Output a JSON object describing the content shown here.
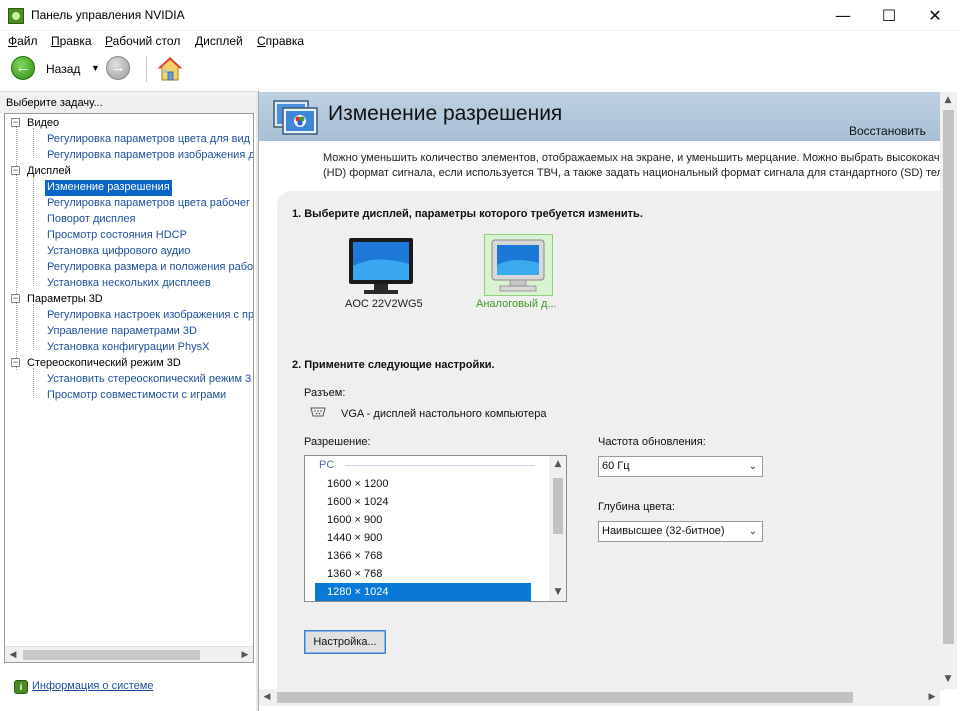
{
  "window": {
    "title": "Панель управления NVIDIA",
    "controls": {
      "minimize": "—",
      "maximize": "☐",
      "close": "✕"
    }
  },
  "menu": [
    {
      "label": "Файл",
      "accel": "Ф",
      "rest": "айл"
    },
    {
      "label": "Правка",
      "accel": "П",
      "rest": "равка"
    },
    {
      "label": "Рабочий стол",
      "accel": "Р",
      "rest": "абочий стол"
    },
    {
      "label": "Дисплей",
      "accel": "Д",
      "rest": "исплей"
    },
    {
      "label": "Справка",
      "accel": "С",
      "rest": "правка"
    }
  ],
  "toolbar": {
    "back_label": "Назад",
    "back_icon": "arrow-left-icon",
    "forward_icon": "arrow-right-icon",
    "home_icon": "home-icon",
    "dropdown_glyph": "▼"
  },
  "sidebar": {
    "header": "Выберите задачу...",
    "categories": [
      {
        "label": "Видео",
        "items": [
          "Регулировка параметров цвета для вид",
          "Регулировка параметров изображения д"
        ]
      },
      {
        "label": "Дисплей",
        "items": [
          "Изменение разрешения",
          "Регулировка параметров цвета рабочег",
          "Поворот дисплея",
          "Просмотр состояния HDCP",
          "Установка цифрового аудио",
          "Регулировка размера и положения рабо",
          "Установка нескольких дисплеев"
        ]
      },
      {
        "label": "Параметры 3D",
        "items": [
          "Регулировка настроек изображения с пр",
          "Управление параметрами 3D",
          "Установка конфигурации PhysX"
        ]
      },
      {
        "label": "Стереоскопический режим 3D",
        "items": [
          "Установить стереоскопический режим 3",
          "Просмотр совместимости с играми"
        ]
      }
    ],
    "selected_item": "Изменение разрешения",
    "system_info_link": "Информация о системе"
  },
  "main": {
    "title": "Изменение разрешения",
    "restore_link": "Восстановить",
    "description_line1": "Можно уменьшить количество элементов, отображаемых на экране, и уменьшить мерцание. Можно выбрать высококач",
    "description_line2": "(HD) формат сигнала, если используется ТВЧ, а также задать национальный формат сигнала для стандартного (SD) тел",
    "step1_title": "1. Выберите дисплей, параметры которого требуется изменить.",
    "displays": [
      {
        "label": "AOC 22V2WG5",
        "selected": false
      },
      {
        "label": "Аналоговый д...",
        "selected": true
      }
    ],
    "step2_title": "2. Примените следующие настройки.",
    "connector_label": "Разъем:",
    "connector_value": "VGA - дисплей настольного компьютера",
    "resolution_label": "Разрешение:",
    "resolution_group": "PC",
    "resolutions": [
      "1600 × 1200",
      "1600 × 1024",
      "1600 × 900",
      "1440 × 900",
      "1366 × 768",
      "1360 × 768",
      "1280 × 1024"
    ],
    "selected_resolution": "1280 × 1024",
    "refresh_label": "Частота обновления:",
    "refresh_value": "60 Гц",
    "depth_label": "Глубина цвета:",
    "depth_value": "Наивысшее (32-битное)",
    "customize_button": "Настройка..."
  },
  "colors": {
    "banner": "#b4c8dc",
    "link": "#1f4f9c",
    "selection": "#0a64c8",
    "selected_display_text": "#3a9a25"
  }
}
